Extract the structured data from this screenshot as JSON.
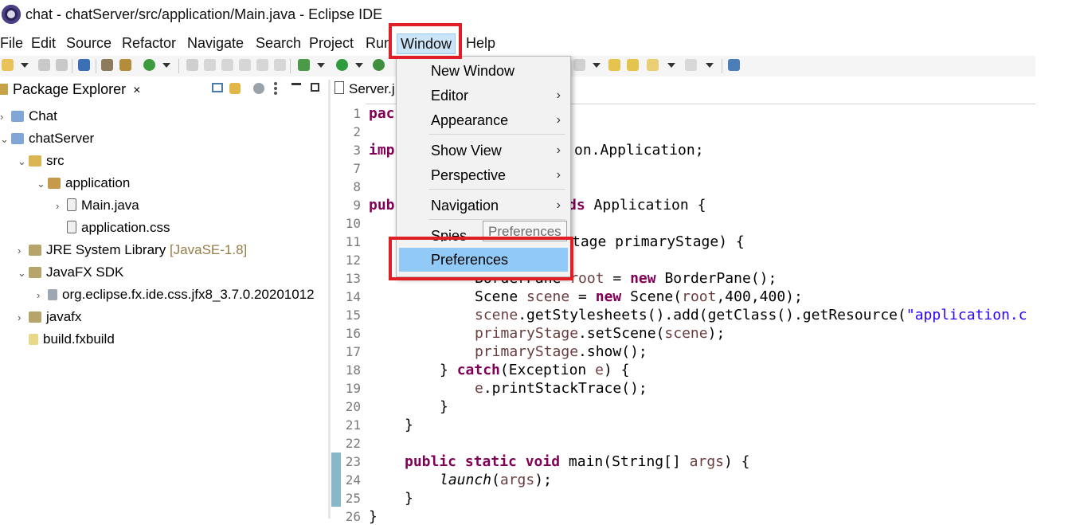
{
  "window": {
    "title": "chat - chatServer/src/application/Main.java - Eclipse IDE"
  },
  "menubar": {
    "items": [
      "File",
      "Edit",
      "Source",
      "Refactor",
      "Navigate",
      "Search",
      "Project",
      "Run",
      "Window",
      "Help"
    ]
  },
  "package_explorer": {
    "tab_label": "Package Explorer",
    "close_glyph": "×",
    "tree": [
      {
        "label": "Chat"
      },
      {
        "label": "chatServer"
      },
      {
        "label": "src"
      },
      {
        "label": "application"
      },
      {
        "label": "Main.java"
      },
      {
        "label": "application.css"
      },
      {
        "label": "JRE System Library",
        "decoration": "[JavaSE-1.8]"
      },
      {
        "label": "JavaFX SDK"
      },
      {
        "label": "org.eclipse.fx.ide.css.jfx8_3.7.0.20201012"
      },
      {
        "label": "javafx"
      },
      {
        "label": "build.fxbuild"
      }
    ]
  },
  "editor": {
    "tab_label": "Server.j",
    "line_numbers": [
      "1",
      "2",
      "3",
      "7",
      "8",
      "9",
      "10",
      "11",
      "12",
      "13",
      "14",
      "15",
      "16",
      "17",
      "18",
      "19",
      "20",
      "21",
      "22",
      "23",
      "24",
      "25",
      "26"
    ],
    "code": {
      "l1": "pac",
      "l3_kw": "imp",
      "l3_rest": "on.Application;",
      "l9_kw": "pub",
      "l9_kw2": "ds",
      "l9_rest": " Application {",
      "l11": "tage primaryStage) {",
      "l13a": "BorderPane ",
      "l13b": "root",
      "l13c": " = ",
      "l13d": "new",
      "l13e": " BorderPane();",
      "l14a": "Scene ",
      "l14b": "scene",
      "l14c": " = ",
      "l14d": "new",
      "l14e": " Scene(",
      "l14f": "root",
      "l14g": ",400,400);",
      "l15a": "scene",
      "l15b": ".getStylesheets().add(getClass().getResource(",
      "l15c": "\"application.c",
      "l16a": "primaryStage",
      "l16b": ".setScene(",
      "l16c": "scene",
      "l16d": ");",
      "l17a": "primaryStage",
      "l17b": ".show();",
      "l18a": "} ",
      "l18b": "catch",
      "l18c": "(Exception ",
      "l18d": "e",
      "l18e": ") {",
      "l19a": "e",
      "l19b": ".printStackTrace();",
      "l20": "}",
      "l21": "}",
      "l23a": "public static void",
      "l23b": " main(String[] ",
      "l23c": "args",
      "l23d": ") {",
      "l24a": "launch",
      "l24b": "(",
      "l24c": "args",
      "l24d": ");",
      "l25": "}",
      "l26": "}"
    }
  },
  "window_menu": {
    "items": [
      {
        "label": "New Window",
        "submenu": false
      },
      {
        "label": "Editor",
        "submenu": true
      },
      {
        "label": "Appearance",
        "submenu": true
      },
      {
        "label": "Show View",
        "submenu": true
      },
      {
        "label": "Perspective",
        "submenu": true
      },
      {
        "label": "Navigation",
        "submenu": true
      },
      {
        "label": "Spies",
        "submenu": false
      },
      {
        "label": "Preferences",
        "submenu": false
      }
    ],
    "submenu_glyph": "›",
    "tooltip": "Preferences"
  },
  "colors": {
    "highlight": "#e01e26",
    "selection": "#91c9f7",
    "keyword": "#7f0055"
  }
}
